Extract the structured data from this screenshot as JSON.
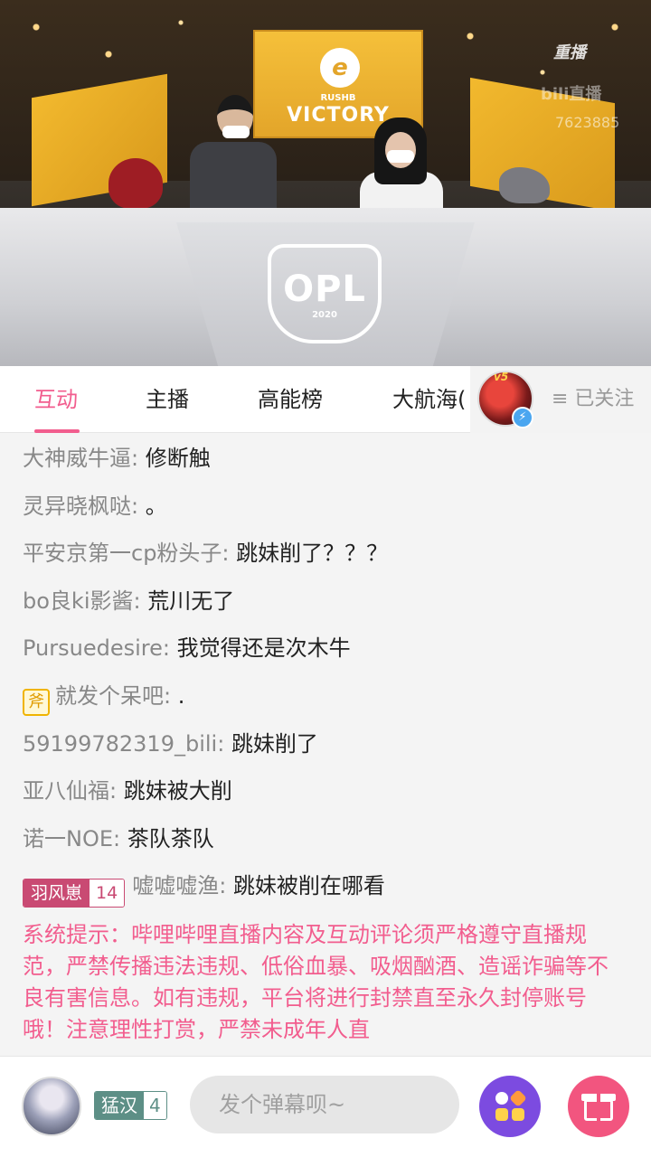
{
  "video": {
    "screen_team": "RUSHB",
    "screen_headline": "VICTORY",
    "screen_logo_glyph": "e",
    "stage_badge": "OPL",
    "stage_year": "2020",
    "replay_label": "重播",
    "platform_watermark": "bili直播",
    "room_id_partial": "7623885",
    "streamer_level_mark": "v5"
  },
  "tabs": [
    {
      "label": "互动",
      "active": true
    },
    {
      "label": "主播",
      "active": false
    },
    {
      "label": "高能榜",
      "active": false
    },
    {
      "label": "大航海(",
      "active": false
    }
  ],
  "follow": {
    "label": "≡ 已关注",
    "verified_icon": "lightning-icon"
  },
  "chat": {
    "messages": [
      {
        "user": "大神威牛逼:",
        "text": "修断触"
      },
      {
        "user": "灵异晓枫哒:",
        "text": "。"
      },
      {
        "user": "平安京第一cp粉头子:",
        "text": "跳妹削了？？？"
      },
      {
        "user": "bo良ki影酱:",
        "text": "荒川无了"
      },
      {
        "user": "Pursuedesire:",
        "text": "我觉得还是次木牛"
      },
      {
        "user": "就发个呆吧:",
        "text": ".",
        "badge": "斧"
      },
      {
        "user": "59199782319_bili:",
        "text": "跳妹削了"
      },
      {
        "user": "亚八仙福:",
        "text": "跳妹被大削"
      },
      {
        "user": "诺一NOE:",
        "text": "茶队茶队"
      },
      {
        "user": "嘘嘘嘘渔:",
        "text": "跳妹被削在哪看",
        "medal_name": "羽风崽",
        "medal_level": "14"
      }
    ],
    "system_notice": "系统提示：哔哩哔哩直播内容及互动评论须严格遵守直播规范，严禁传播违法违规、低俗血暴、吸烟酗酒、造谣诈骗等不良有害信息。如有违规，平台将进行封禁直至永久封停账号哦！注意理性打赏，严禁未成年人直"
  },
  "bottom": {
    "medal_name": "猛汉",
    "medal_level": "4",
    "input_placeholder": "发个弹幕呗~"
  },
  "colors": {
    "accent": "#f25d8e",
    "username": "#888888",
    "medal_pink": "#c94a73",
    "medal_teal": "#5d8f86",
    "func_button": "#7c4be0"
  }
}
